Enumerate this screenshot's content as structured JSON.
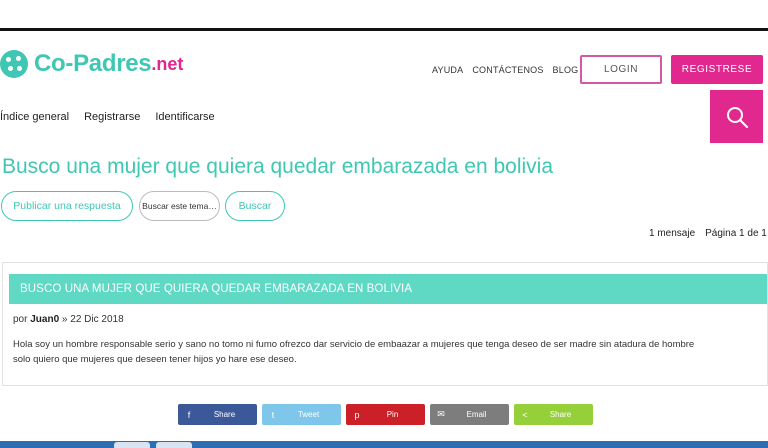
{
  "header": {
    "logo_main": "Co-Padres",
    "logo_suffix": ".net",
    "nav": [
      "AYUDA",
      "CONTÁCTENOS",
      "BLOG"
    ],
    "login_label": "LOGIN",
    "register_label": "REGISTRESE"
  },
  "sub_nav": [
    "Índice general",
    "Registrarse",
    "Identificarse"
  ],
  "topic": {
    "title": "Busco una mujer que quiera quedar embarazada en bolivia",
    "reply_label": "Publicar una respuesta",
    "search_placeholder": "Buscar este tema…",
    "search_button": "Buscar",
    "message_count": "1 mensaje",
    "page_info": "Página 1 de 1"
  },
  "post": {
    "title": "BUSCO UNA MUJER QUE QUIERA QUEDAR EMBARAZADA EN BOLIVIA",
    "by_label": "por",
    "author": "Juan0",
    "date": "» 22 Dic 2018",
    "body_line1": "Hola soy un hombre responsable serio y sano no tomo ni fumo ofrezco dar servicio de embaazar a mujeres que tenga deseo de ser madre sin atadura de hombre",
    "body_line2": "solo quiero que mujeres que deseen tener hijos yo hare ese deseo."
  },
  "share": [
    {
      "label": "Share",
      "icon": "facebook-icon",
      "glyph": "f"
    },
    {
      "label": "Tweet",
      "icon": "twitter-icon",
      "glyph": "t"
    },
    {
      "label": "Pin",
      "icon": "pinterest-icon",
      "glyph": "p"
    },
    {
      "label": "Email",
      "icon": "email-icon",
      "glyph": "✉"
    },
    {
      "label": "Share",
      "icon": "share-icon",
      "glyph": "<"
    }
  ],
  "colors": {
    "brand_teal": "#3fc7b3",
    "brand_pink": "#e0288e",
    "post_header": "#5fd9c4"
  }
}
